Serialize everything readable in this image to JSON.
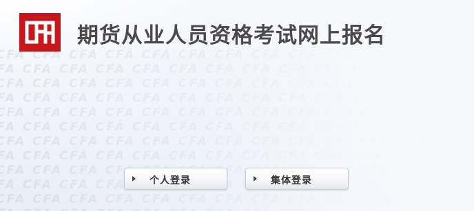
{
  "header": {
    "logo_text": "CFA",
    "title": "期货从业人员资格考试网上报名",
    "brand_color": "#c8161d"
  },
  "background": {
    "watermark_text": "CFA"
  },
  "login": {
    "personal_label": "个人登录",
    "group_label": "集体登录"
  },
  "icons": {
    "logo": "cfa-logo-icon",
    "button_arrow": "triangle-right-icon"
  }
}
